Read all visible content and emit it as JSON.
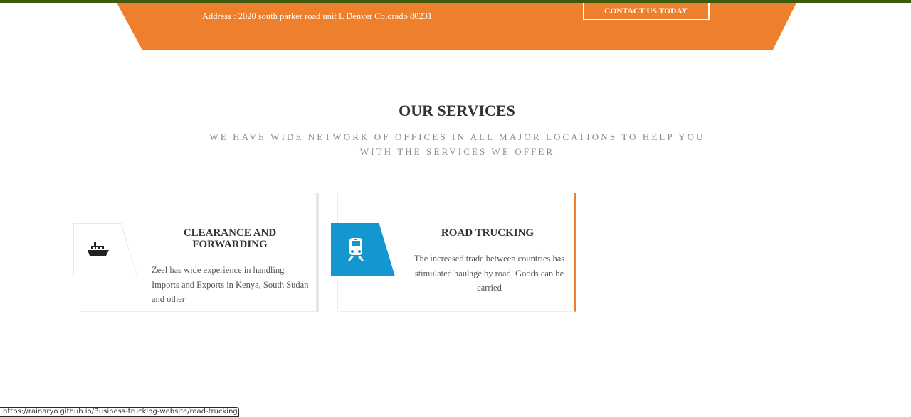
{
  "header": {
    "address": "Address : 2020 south parker road unit L Denver Colorado 80231.",
    "contact_label": "CONTACT US TODAY"
  },
  "services": {
    "title": "OUR SERVICES",
    "subtitle": "WE HAVE WIDE NETWORK OF OFFICES IN ALL MAJOR LOCATIONS TO HELP YOU WITH THE SERVICES WE OFFER",
    "items": [
      {
        "title": "CLEARANCE AND FORWARDING",
        "text": "Zeel has wide experience in handling Imports and Exports in Kenya, South Sudan and other",
        "icon": "ship-icon"
      },
      {
        "title": "ROAD TRUCKING",
        "text": "The increased trade between countries has stimulated haulage by road. Goods can be carried",
        "icon": "train-icon"
      }
    ]
  },
  "status_url": "https://rainaryo.github.io/Business-trucking-website/road-trucking.html",
  "colors": {
    "orange": "#ee7f2d",
    "blue": "#1496d0",
    "green": "#3d5a0c"
  }
}
